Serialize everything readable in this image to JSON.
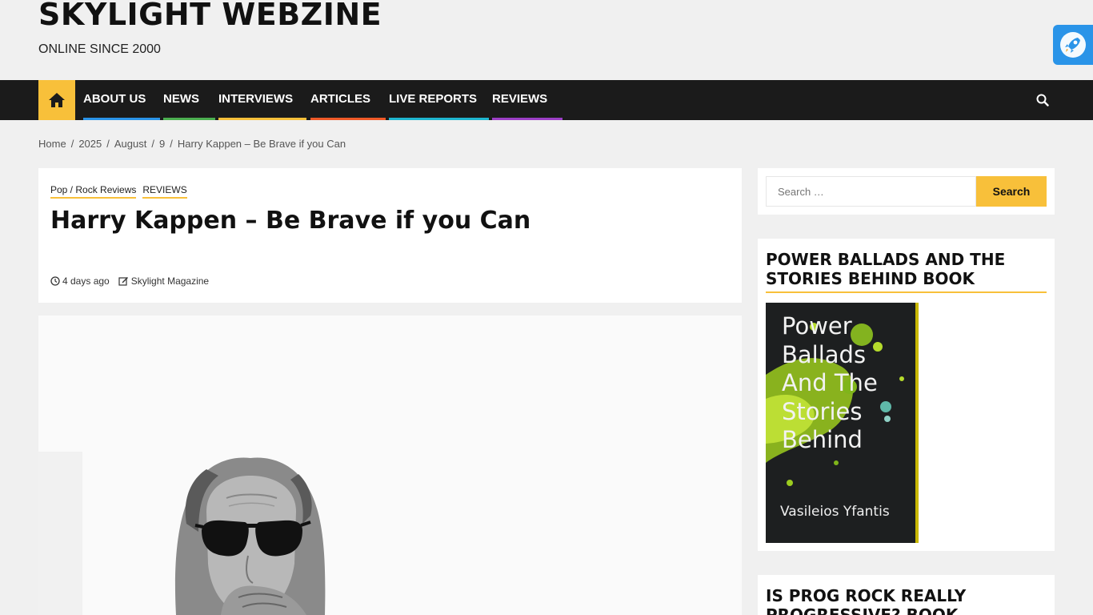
{
  "site": {
    "title": "SKYLIGHT WEBZINE",
    "tagline": "ONLINE SINCE 2000"
  },
  "nav": {
    "home_icon": "home-icon",
    "items": [
      {
        "label": "ABOUT US",
        "color": "#2a94e8"
      },
      {
        "label": "NEWS",
        "color": "#4caf50"
      },
      {
        "label": "INTERVIEWS",
        "color": "#f8c03a"
      },
      {
        "label": "ARTICLES",
        "color": "#f05a28"
      },
      {
        "label": "LIVE REPORTS",
        "color": "#1fb6d0"
      },
      {
        "label": "REVIEWS",
        "color": "#9c3fc6"
      }
    ],
    "search_icon": "search-icon"
  },
  "breadcrumb": [
    "Home",
    "2025",
    "August",
    "9",
    "Harry Kappen – Be Brave if you Can"
  ],
  "article": {
    "categories": [
      "Pop / Rock Reviews",
      "REVIEWS"
    ],
    "title": "Harry Kappen – Be Brave if you Can",
    "date": "4 days ago",
    "author": "Skylight Magazine"
  },
  "sidebar": {
    "search_placeholder": "Search …",
    "search_button": "Search",
    "book_widget_title": "POWER BALLADS AND THE STORIES BEHIND BOOK",
    "book_cover_title": "Power\nBallads\nAnd The\nStories\nBehind",
    "book_cover_author": "Vasileios Yfantis",
    "prog_widget_title": "IS PROG ROCK REALLY PROGRESSIVE? BOOK"
  },
  "colors": {
    "accent": "#f8c03a",
    "nav_bg": "#1b1b1b",
    "page_bg": "#f0f0f0"
  }
}
